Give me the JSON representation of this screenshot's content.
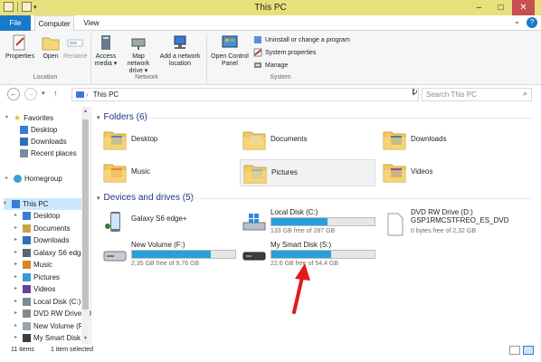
{
  "window": {
    "title": "This PC"
  },
  "tabs": {
    "file": "File",
    "computer": "Computer",
    "view": "View"
  },
  "ribbon": {
    "location": {
      "label": "Location",
      "properties": "Properties",
      "open": "Open",
      "rename": "Rename"
    },
    "network": {
      "label": "Network",
      "access_media_1": "Access",
      "access_media_2": "media ▾",
      "map_drive_1": "Map network",
      "map_drive_2": "drive ▾",
      "add_location_1": "Add a network",
      "add_location_2": "location"
    },
    "system": {
      "label": "System",
      "control_panel_1": "Open Control",
      "control_panel_2": "Panel",
      "uninstall": "Uninstall or change a program",
      "system_properties": "System properties",
      "manage": "Manage"
    }
  },
  "navigation": {
    "back": "←",
    "forward": "→",
    "recent": "▾",
    "up": "↑",
    "address_sep": "›",
    "address": "This PC",
    "search_placeholder": "Search This PC"
  },
  "nav_pane": {
    "favorites": "Favorites",
    "desktop": "Desktop",
    "downloads": "Downloads",
    "recent_places": "Recent places",
    "homegroup": "Homegroup",
    "this_pc": "This PC",
    "tree": [
      "Desktop",
      "Documents",
      "Downloads",
      "Galaxy S6 edge+",
      "Music",
      "Pictures",
      "Videos",
      "Local Disk (C:)",
      "DVD RW Drive (D",
      "New Volume (F:)",
      "My Smart Disk (S"
    ]
  },
  "folders": {
    "header": "Folders (6)",
    "items": [
      "Desktop",
      "Documents",
      "Downloads",
      "Music",
      "Pictures",
      "Videos"
    ]
  },
  "devices": {
    "header": "Devices and drives (5)",
    "galaxy": "Galaxy S6 edge+",
    "local_c": {
      "name": "Local Disk (C:)",
      "free": "133 GB free of 287 GB",
      "used_fraction": 0.54
    },
    "dvd": {
      "name": "DVD RW Drive (D:)",
      "label": "GSP1RMCSTFREO_ES_DVD",
      "free": "0 bytes free of 2,32 GB"
    },
    "new_volume": {
      "name": "New Volume (F:)",
      "free": "2,35 GB free of 9,76 GB",
      "used_fraction": 0.76
    },
    "smart_disk": {
      "name": "My Smart Disk (S:)",
      "free": "22,6 GB free of 54,4 GB",
      "used_fraction": 0.58
    }
  },
  "status": {
    "items": "11 items",
    "selected": "1 item selected"
  }
}
